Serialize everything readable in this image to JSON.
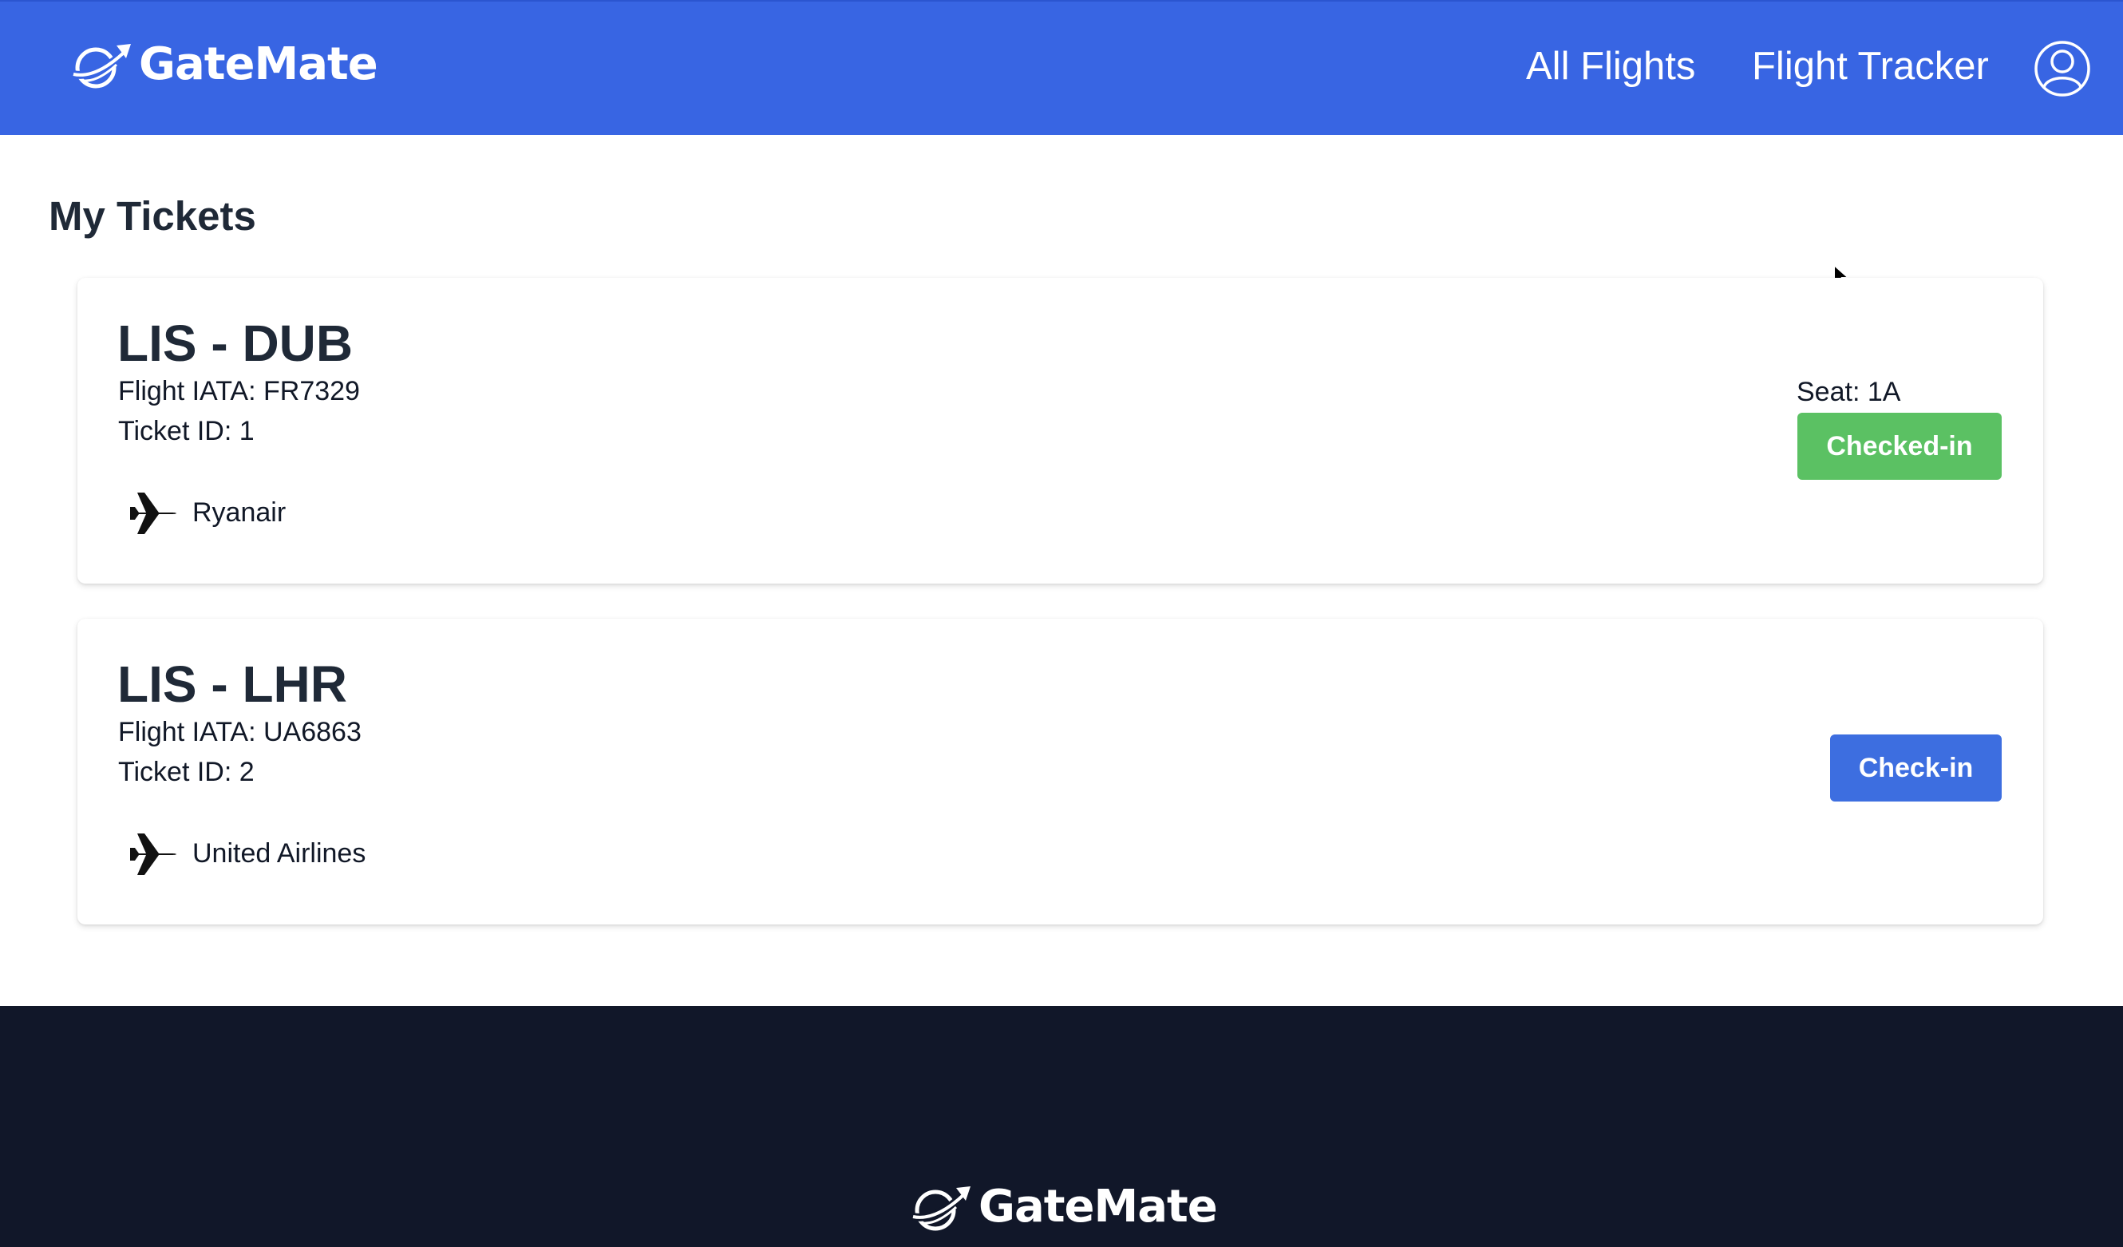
{
  "header": {
    "brand": "GateMate",
    "nav": {
      "all_flights": "All Flights",
      "flight_tracker": "Flight Tracker"
    },
    "profile_icon": "user-circle-icon"
  },
  "main": {
    "title": "My Tickets",
    "tickets": [
      {
        "route": "LIS - DUB",
        "iata": "Flight IATA: FR7329",
        "ticket_id": "Ticket ID: 1",
        "airline": "Ryanair",
        "seat": "Seat: 1A",
        "status_button": "Checked-in"
      },
      {
        "route": "LIS - LHR",
        "iata": "Flight IATA: UA6863",
        "ticket_id": "Ticket ID: 2",
        "airline": "United Airlines",
        "action_button": "Check-in"
      }
    ]
  },
  "footer": {
    "brand": "GateMate"
  },
  "colors": {
    "header_bg": "#3865e3",
    "checked_in": "#5bc163",
    "check_in": "#3d6ee0",
    "footer_bg": "#111729"
  }
}
